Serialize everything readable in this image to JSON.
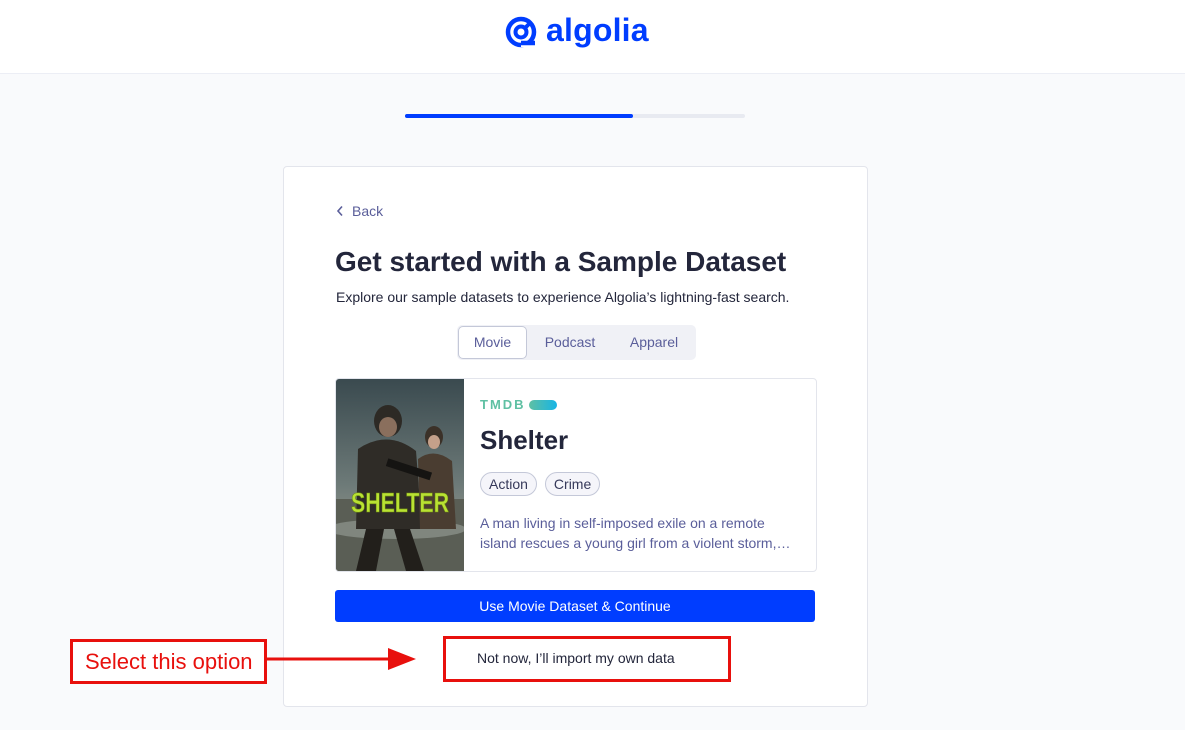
{
  "header": {
    "logo_text": "algolia",
    "logo_icon": "algolia-logo-icon",
    "brand_color": "#003dff"
  },
  "progress": {
    "fraction": 0.67
  },
  "card": {
    "back_label": "Back",
    "title": "Get started with a Sample Dataset",
    "subtitle": "Explore our sample datasets to experience Algolia’s lightning-fast search.",
    "tabs": [
      {
        "label": "Movie",
        "active": true
      },
      {
        "label": "Podcast",
        "active": false
      },
      {
        "label": "Apparel",
        "active": false
      }
    ],
    "preview": {
      "source": "TMDB",
      "title": "Shelter",
      "poster_text": "SHELTER",
      "genres": [
        "Action",
        "Crime"
      ],
      "description_line1": "A man living in self-imposed exile on a remote",
      "description_line2": "island rescues a young girl from a violent storm,…"
    },
    "cta_label": "Use Movie Dataset & Continue",
    "skip_label": "Not now, I’ll import my own data"
  },
  "annotation": {
    "label": "Select this option",
    "color": "#e8100d"
  }
}
